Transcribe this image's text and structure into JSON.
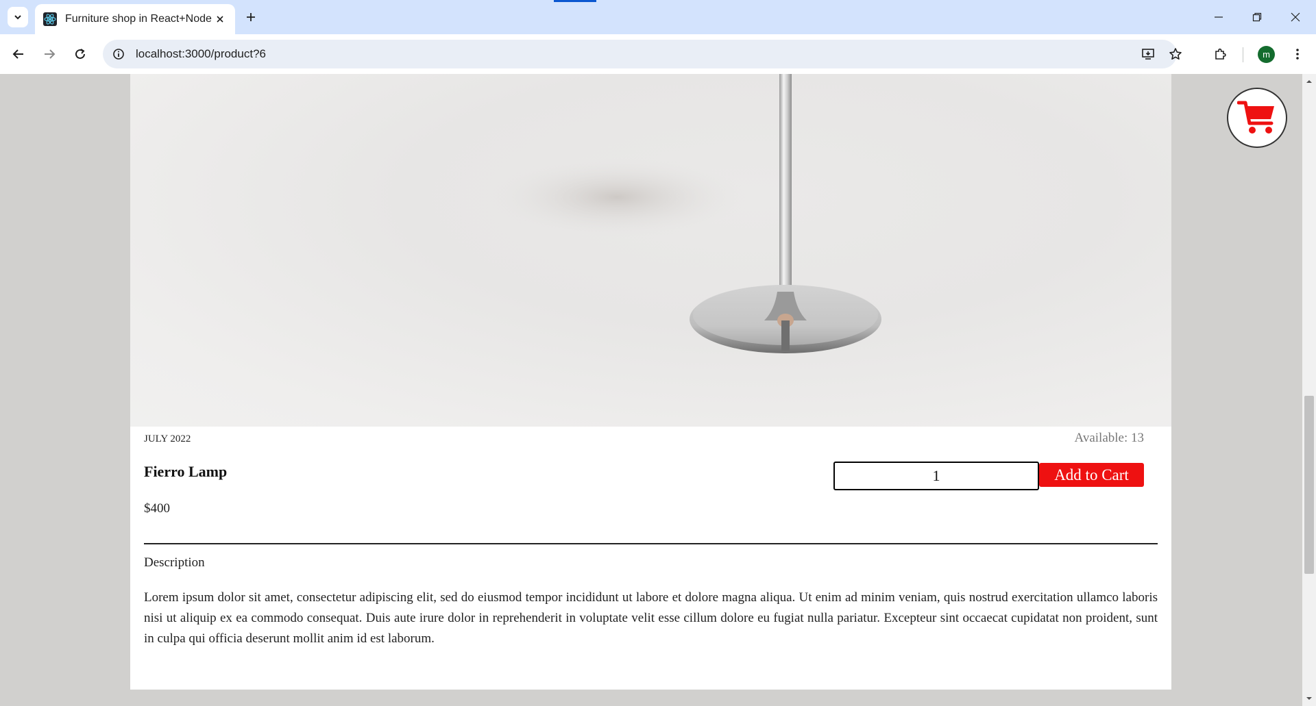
{
  "browser": {
    "tab_title": "Furniture shop in React+Node",
    "url": "localhost:3000/product?6",
    "profile_initial": "m",
    "icons": {
      "tab_search": "chevron-down-icon",
      "favicon": "react-icon",
      "tab_close": "close-icon",
      "new_tab": "plus-icon",
      "back": "arrow-left-icon",
      "forward": "arrow-right-icon",
      "reload": "reload-icon",
      "site_info": "info-icon",
      "install": "install-app-icon",
      "bookmark": "star-icon",
      "extensions": "puzzle-icon",
      "menu": "kebab-menu-icon",
      "minimize": "minimize-icon",
      "restore": "restore-icon",
      "close": "close-window-icon"
    }
  },
  "product": {
    "date": "JULY 2022",
    "available": "Available: 13",
    "name": "Fierro Lamp",
    "price": "$400",
    "quantity": "1",
    "add_to_cart_label": "Add to Cart",
    "description_heading": "Description",
    "description": "Lorem ipsum dolor sit amet, consectetur adipiscing elit, sed do eiusmod tempor incididunt ut labore et dolore magna aliqua. Ut enim ad minim veniam, quis nostrud exercitation ullamco laboris nisi ut aliquip ex ea commodo consequat. Duis aute irure dolor in reprehenderit in voluptate velit esse cillum dolore eu fugiat nulla pariatur. Excepteur sint occaecat cupidatat non proident, sunt in culpa qui officia deserunt mollit anim id est laborum."
  },
  "cart": {
    "icon": "shopping-cart-icon",
    "color": "#ee1111"
  },
  "colors": {
    "accent": "#ee1111",
    "chrome_tabbar": "#d3e3fd",
    "page_bg": "#d1d0ce"
  }
}
